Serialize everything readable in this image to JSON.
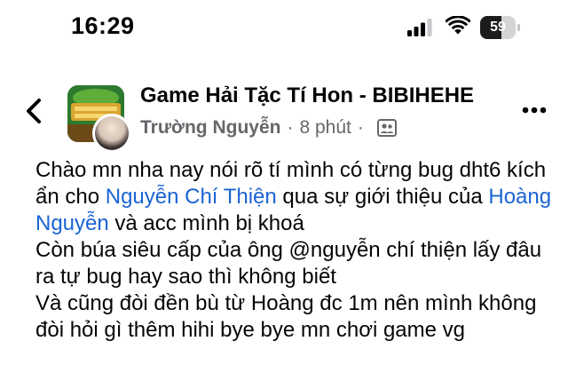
{
  "status_bar": {
    "time": "16:29",
    "battery_level": "59",
    "battery_fraction": 0.59,
    "icons": [
      "signal-icon",
      "wifi-icon",
      "battery-icon"
    ]
  },
  "header": {
    "back_icon": "chevron-left-icon",
    "group_name": "Game Hải Tặc Tí Hon - BIBIHEHE",
    "author_name": "Trường Nguyễn",
    "separator": "·",
    "time_ago": "8 phút",
    "separator2": "·",
    "privacy_icon": "group-members-icon",
    "more_icon": "more-horizontal-icon"
  },
  "post": {
    "line1": "Chào mn nha nay nói rõ tí mình có từng bug dht6 kích",
    "line2_pre": "ẩn cho ",
    "mention1": "Nguyễn Chí Thiện",
    "line2_mid": " qua sự giới thiệu của ",
    "mention2_part1": "Hoàng",
    "mention2_part2": "Nguyễn",
    "line3_post": " và acc mình bị khoá",
    "line4": "Còn búa siêu cấp của ông @nguyễn chí thiện lấy đâu",
    "line5": "ra tự bug hay sao thì không biết",
    "line6": "Và cũng đòi đền bù từ Hoàng đc 1m nên mình không",
    "line7": "đòi hỏi gì thêm hihi bye bye mn chơi game vg"
  },
  "colors": {
    "mention": "#1b64d4",
    "meta": "#65676b",
    "text": "#050505"
  }
}
